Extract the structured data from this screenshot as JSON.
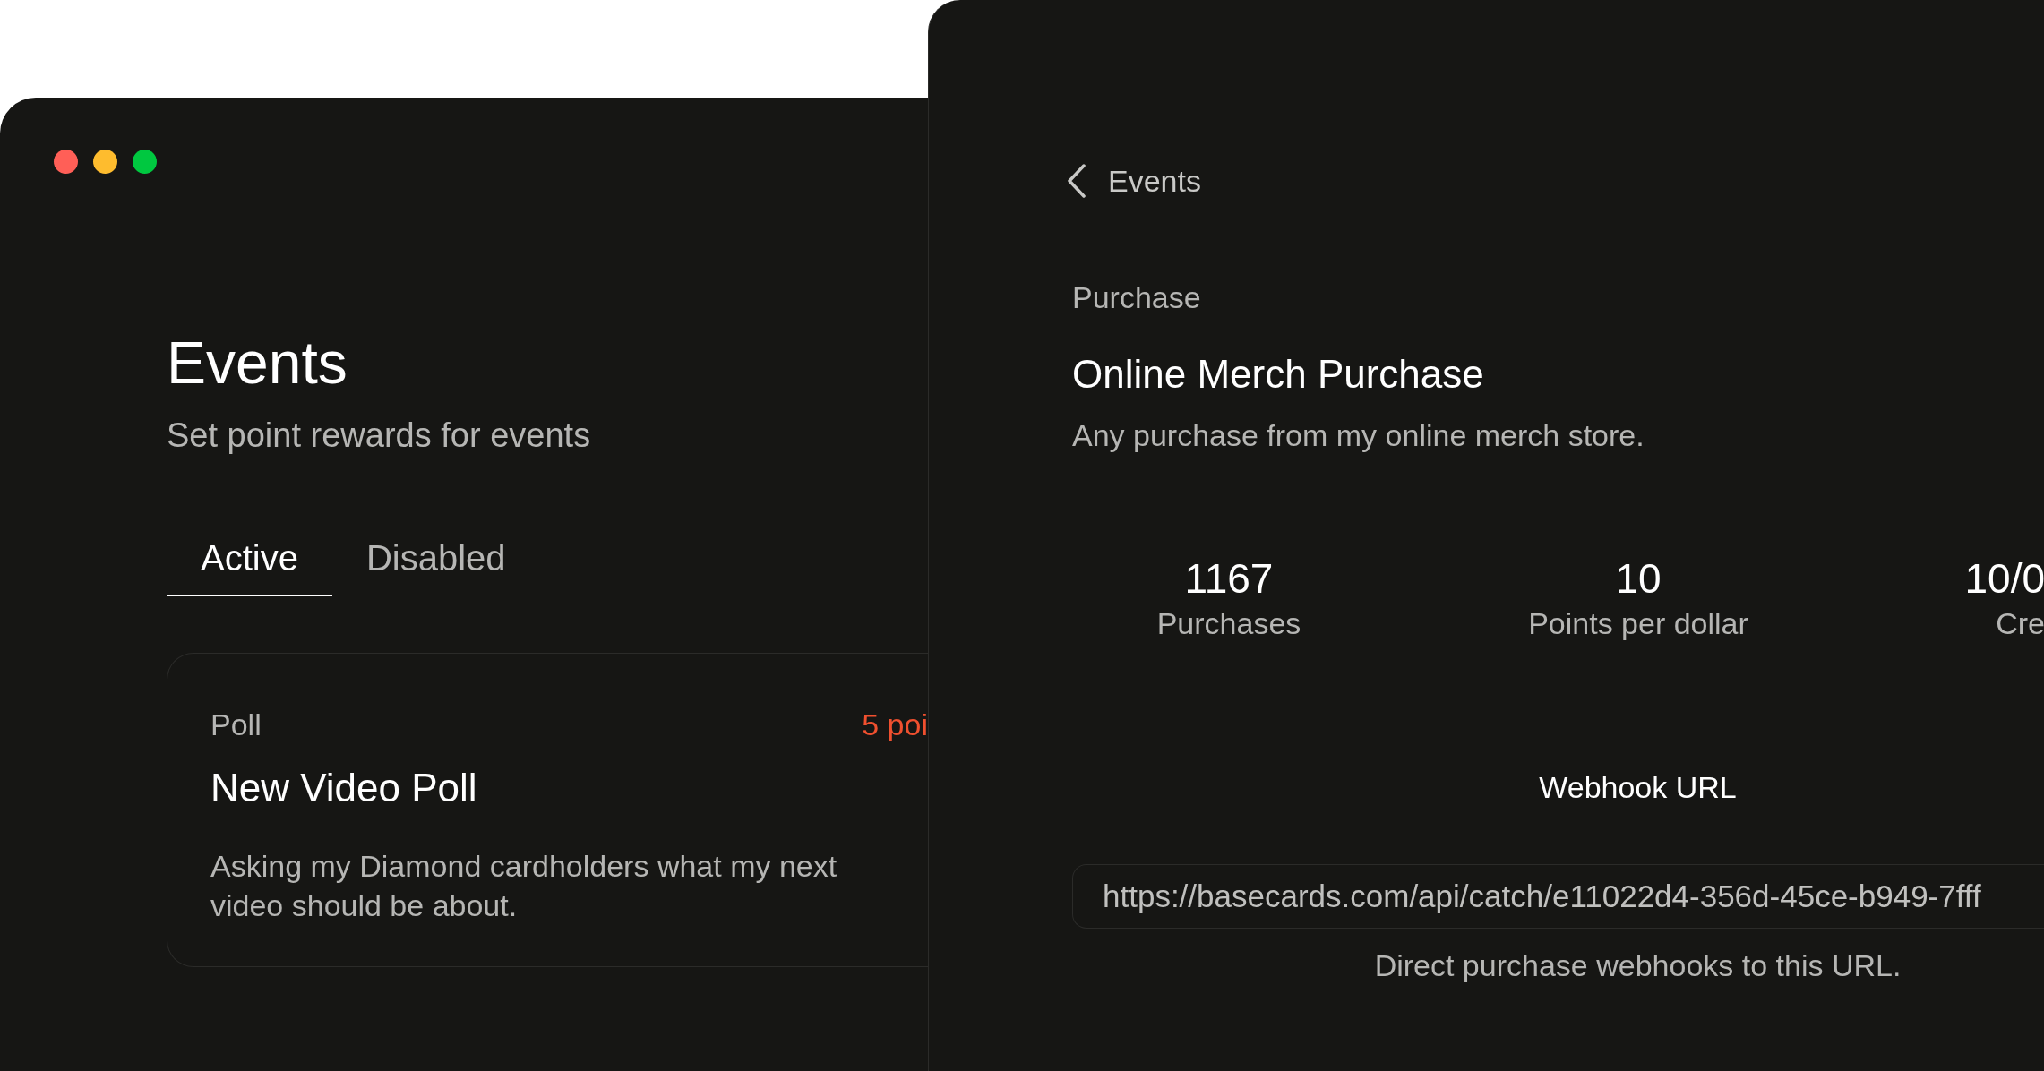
{
  "window_controls": [
    {
      "color": "#ff5f57"
    },
    {
      "color": "#febc2e"
    },
    {
      "color": "#00c840"
    }
  ],
  "events_window": {
    "title": "Events",
    "subtitle": "Set point rewards for events",
    "tabs": [
      {
        "label": "Active",
        "selected": true
      },
      {
        "label": "Disabled",
        "selected": false
      }
    ],
    "cards": [
      {
        "type": "Poll",
        "points": "5 poi",
        "title": "New Video Poll",
        "description": "Asking my Diamond cardholders what my next video should be about."
      }
    ]
  },
  "detail_window": {
    "back": {
      "label": "Events"
    },
    "type": "Purchase",
    "title": "Online Merch Purchase",
    "description": "Any purchase from my online merch store.",
    "stats": [
      {
        "value": "1167",
        "label": "Purchases"
      },
      {
        "value": "10",
        "label": "Points per dollar"
      },
      {
        "value": "10/0",
        "label": "Cre"
      }
    ],
    "webhook": {
      "label": "Webhook URL",
      "value": "https://basecards.com/api/catch/e11022d4-356d-45ce-b949-7fff",
      "help": "Direct purchase webhooks to this URL."
    }
  }
}
